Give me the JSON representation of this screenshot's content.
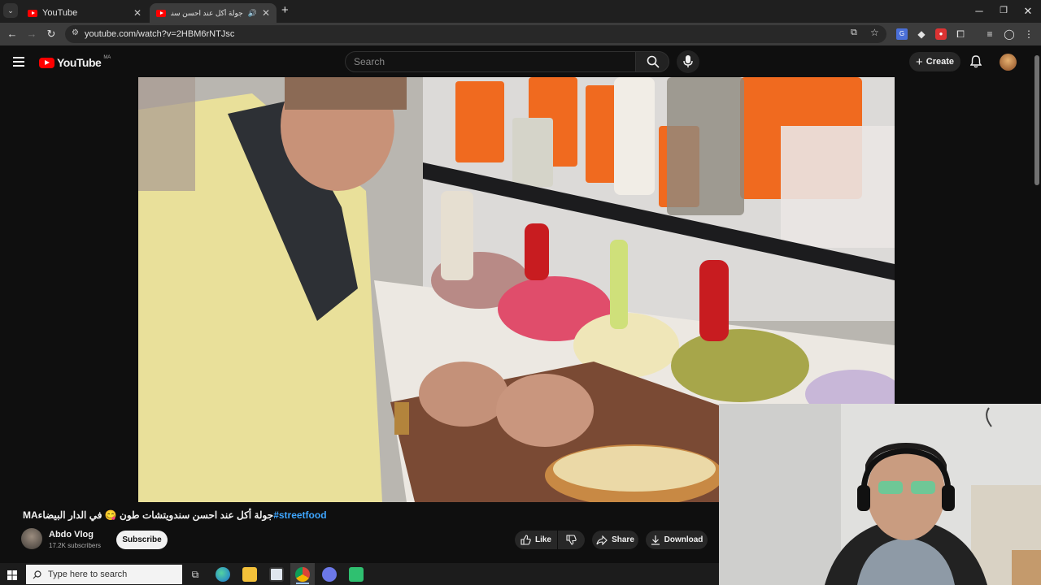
{
  "browser": {
    "tabs": [
      {
        "title": "YouTube",
        "active": false
      },
      {
        "title": "جولة أكل عند احسن سندويتـ",
        "active": true
      }
    ],
    "new_tab_label": "+",
    "url": "youtube.com/watch?v=2HBM6rNTJsc"
  },
  "youtube": {
    "logo_text": "YouTube",
    "region": "MA",
    "search_placeholder": "Search",
    "create_label": "Create"
  },
  "video": {
    "title_main": "جولة أكل عند احسن سندويتشات طون 😋 في الدار البيضاءMA",
    "title_tag": "#streetfood",
    "channel_name": "Abdo Vlog",
    "subscribers": "17.2K subscribers",
    "subscribe_label": "Subscribe",
    "like_label": "Like",
    "share_label": "Share",
    "download_label": "Download"
  },
  "taskbar": {
    "search_placeholder": "Type here to search"
  },
  "colors": {
    "accent_red": "#ff0000",
    "hashtag_blue": "#3ea6ff",
    "bg": "#0f0f0f"
  },
  "icons": [
    "menu-icon",
    "search-icon",
    "mic-icon",
    "bell-icon",
    "like-icon",
    "dislike-icon",
    "share-icon",
    "download-icon",
    "windows-start-icon"
  ]
}
